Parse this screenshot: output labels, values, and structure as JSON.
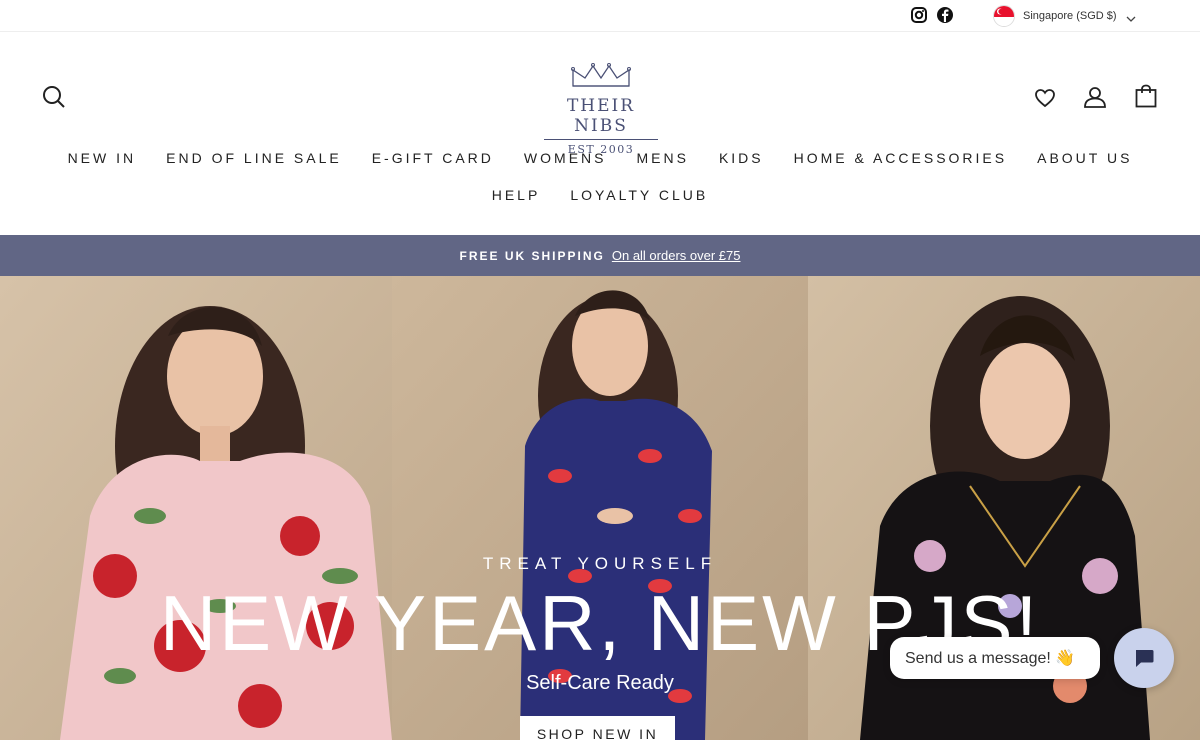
{
  "topbar": {
    "social": [
      "instagram-icon",
      "facebook-icon"
    ],
    "currency": {
      "label": "Singapore (SGD $)",
      "flag": "singapore-flag-icon"
    }
  },
  "header": {
    "logo": {
      "name": "THEIR NIBS",
      "est": "EST 2003",
      "icon": "crown-icon",
      "color": "#4a5075"
    },
    "icons": {
      "search": "search-icon",
      "wishlist": "heart-icon",
      "account": "user-icon",
      "cart": "bag-icon"
    }
  },
  "nav": {
    "row1": [
      "NEW IN",
      "END OF LINE SALE",
      "E-GIFT CARD",
      "WOMENS",
      "MENS",
      "KIDS",
      "HOME & ACCESSORIES",
      "ABOUT US"
    ],
    "row2": [
      "HELP",
      "LOYALTY CLUB"
    ]
  },
  "announcement": {
    "strong": "FREE UK SHIPPING",
    "link": "On all orders over £75",
    "bg": "#616685"
  },
  "hero": {
    "subtitle": "TREAT YOURSELF",
    "title": "NEW YEAR, NEW PJS!",
    "tagline": "Self-Care Ready",
    "button": "SHOP NEW IN"
  },
  "chat": {
    "message": "Send us a message! 👋",
    "icon": "chat-icon"
  }
}
